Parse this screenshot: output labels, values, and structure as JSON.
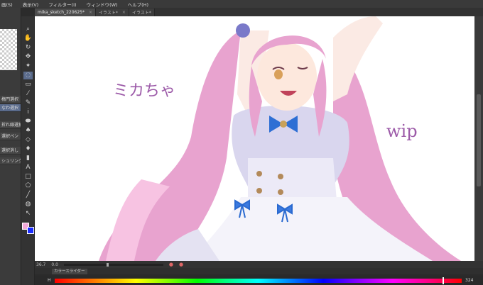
{
  "menu": [
    "画(S)",
    "表示(V)",
    "フィルター(I)",
    "ウィンドウ(W)",
    "ヘルプ(H)"
  ],
  "tabs": [
    {
      "label": "mika_sketch_220625*",
      "close": "×",
      "active": true
    },
    {
      "label": "イラスト*",
      "close": "×",
      "active": false
    },
    {
      "label": "イラスト*",
      "close": "",
      "active": false
    }
  ],
  "subtools": [
    "楕円選択",
    "なわ選択",
    "折れ線選択",
    "選択ペン",
    "選択消し",
    "シュリンク選択"
  ],
  "colors": {
    "main": "#f2a8d8",
    "sub": "#1a2cff",
    "canvas": "#ffffff"
  },
  "status": {
    "zoom": "36.7",
    "angle": "0.0"
  },
  "colorpanel": {
    "tab_label": "カラースライダー"
  },
  "hue": {
    "label": "H",
    "value": "324"
  },
  "canvas_text": {
    "name": "ミカちゃ",
    "wip": "wip"
  }
}
